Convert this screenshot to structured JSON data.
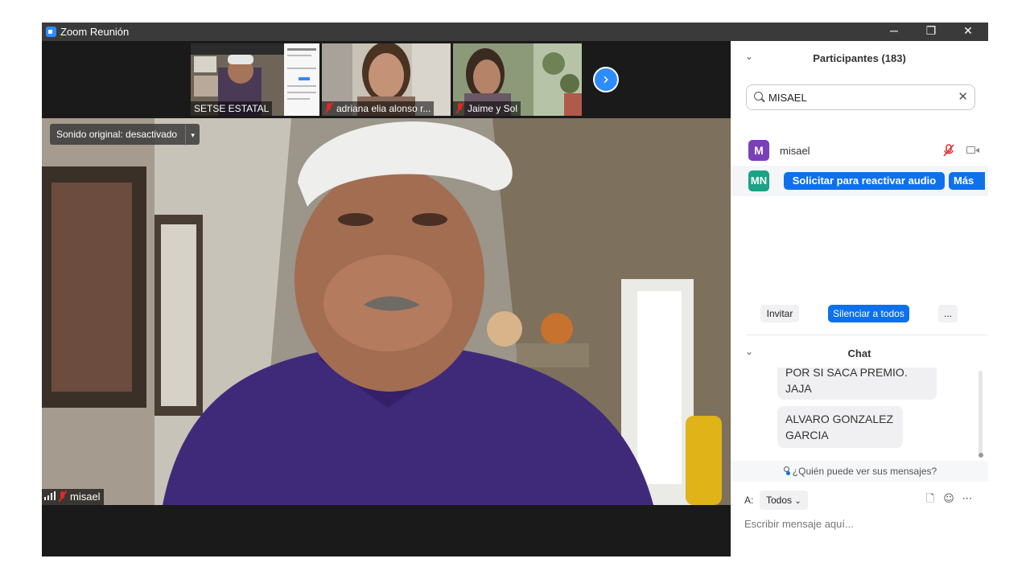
{
  "window": {
    "title": "Zoom Reunión",
    "minimize": "─",
    "restore": "❐",
    "close": "✕"
  },
  "thumbnails": [
    {
      "name": "SETSE ESTATAL",
      "muted": false
    },
    {
      "name": "adriana elia alonso r...",
      "muted": true
    },
    {
      "name": "Jaime y  Sol",
      "muted": true
    }
  ],
  "next_arrow": "›",
  "main_video": {
    "sound_label": "Sonido original: desactivado",
    "dropdown": "▾",
    "speaker": "misael"
  },
  "participants": {
    "title": "Participantes (183)",
    "collapse": "⌄",
    "search_value": "MISAEL",
    "clear": "✕",
    "rows": [
      {
        "initial": "M",
        "name": "misael",
        "color": "#7b3fb8"
      },
      {
        "initial": "MN",
        "color": "#1aa384",
        "action": "Solicitar para reactivar audio",
        "more": "Más"
      }
    ],
    "buttons": {
      "invite": "Invitar",
      "mute_all": "Silenciar a todos",
      "more": "..."
    }
  },
  "chat": {
    "title": "Chat",
    "collapse": "⌄",
    "messages": [
      {
        "lines": [
          "POR SI SACA PREMIO.",
          "JAJA"
        ]
      },
      {
        "lines": [
          "ALVARO GONZALEZ",
          "GARCIA"
        ]
      }
    ],
    "who_can_see": "¿Quién puede ver sus mensajes?",
    "to_label": "A:",
    "to_value": "Todos",
    "to_caret": "⌄",
    "placeholder": "Escribir mensaje aquí...",
    "icons": {
      "file": "🗋",
      "emoji": "☺",
      "more": "⋯"
    }
  },
  "colors": {
    "accent": "#0e71eb",
    "zoom_blue": "#2d8cff",
    "muted_red": "#e02828"
  }
}
